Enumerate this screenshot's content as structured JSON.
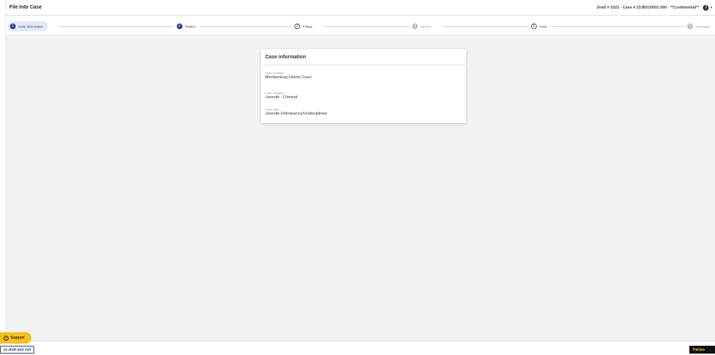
{
  "header": {
    "title": "File Into Case",
    "case_summary": "Draft # 5322 - Case # 23JB010001-590 - **Confidential**",
    "info_icon": "i",
    "info_caret": "▾"
  },
  "stepper": {
    "steps": [
      {
        "num": "1",
        "label": "Case information",
        "state": "active"
      },
      {
        "num": "✔",
        "label": "Parties",
        "state": "complete"
      },
      {
        "num": "3",
        "label": "Filings",
        "state": "outline"
      },
      {
        "num": "4",
        "label": "Service",
        "state": "disabled"
      },
      {
        "num": "5",
        "label": "Fees",
        "state": "outline"
      },
      {
        "num": "6",
        "label": "Summary",
        "state": "disabled"
      }
    ]
  },
  "card": {
    "title": "Case information",
    "fields": [
      {
        "label": "Court Location",
        "value": "Mecklenburg District Court"
      },
      {
        "label": "Case Category",
        "value": "Juvenile - Criminal"
      },
      {
        "label": "Case Type",
        "value": "Juvenile-Delinquency/Undisciplined"
      }
    ]
  },
  "footer": {
    "save_label": "ve draft and exit",
    "next_label": "Parties",
    "next_arrow": "→",
    "support_label": "Support",
    "support_icon": "?"
  },
  "colors": {
    "primary": "#2b4190",
    "support": "#f7c11a",
    "next_text": "#f5c518",
    "background": "#f2f2f2"
  }
}
